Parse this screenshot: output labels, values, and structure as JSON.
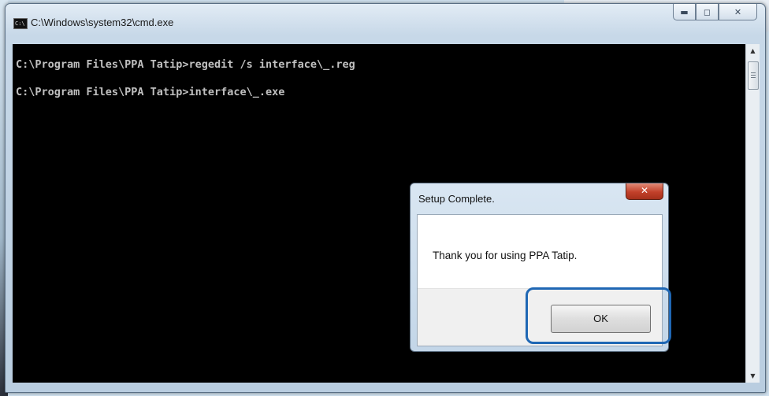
{
  "window": {
    "title": "C:\\Windows\\system32\\cmd.exe",
    "icon": "cmd-icon",
    "caption": {
      "minimize": "minimize-icon",
      "maximize": "maximize-icon",
      "close": "close-icon"
    }
  },
  "console": {
    "lines": [
      "C:\\Program Files\\PPA Tatip>regedit /s interface\\_.reg",
      "C:\\Program Files\\PPA Tatip>interface\\_.exe"
    ],
    "text_color": "#c0c0c0",
    "background": "#000000"
  },
  "dialog": {
    "title": "Setup Complete.",
    "message": "Thank you for using PPA Tatip.",
    "ok_label": "OK",
    "close_symbol": "✕"
  },
  "annotation": {
    "highlight_color": "#1f67b4"
  }
}
